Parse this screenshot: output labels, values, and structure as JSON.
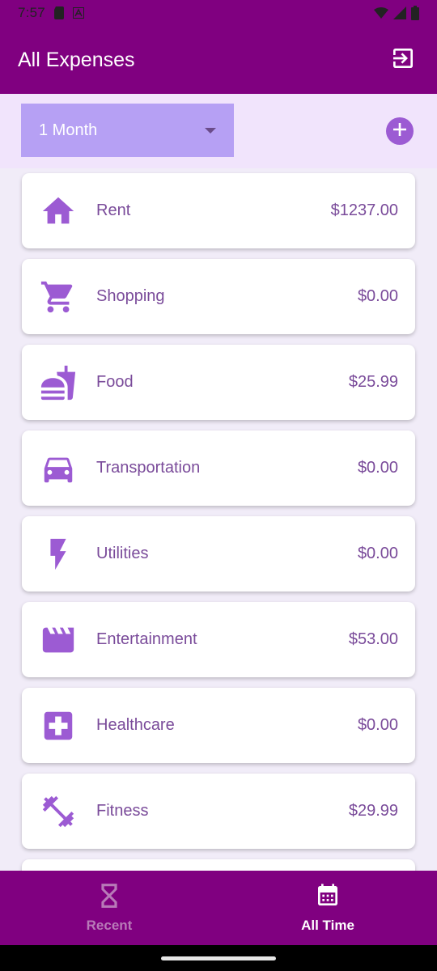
{
  "status_bar": {
    "time": "7:57",
    "icons": [
      "sim-card-icon",
      "a-badge-icon",
      "wifi-icon",
      "signal-icon",
      "battery-icon"
    ]
  },
  "app_bar": {
    "title": "All Expenses",
    "action_icon": "logout-icon"
  },
  "filter": {
    "selected": "1 Month",
    "add_icon": "add-circle-icon"
  },
  "expenses": [
    {
      "label": "Rent",
      "amount": "$1237.00",
      "icon": "home-icon"
    },
    {
      "label": "Shopping",
      "amount": "$0.00",
      "icon": "shopping-cart-icon"
    },
    {
      "label": "Food",
      "amount": "$25.99",
      "icon": "fastfood-icon"
    },
    {
      "label": "Transportation",
      "amount": "$0.00",
      "icon": "car-icon"
    },
    {
      "label": "Utilities",
      "amount": "$0.00",
      "icon": "bolt-icon"
    },
    {
      "label": "Entertainment",
      "amount": "$53.00",
      "icon": "movie-icon"
    },
    {
      "label": "Healthcare",
      "amount": "$0.00",
      "icon": "medical-icon"
    },
    {
      "label": "Fitness",
      "amount": "$29.99",
      "icon": "fitness-icon"
    }
  ],
  "bottom_nav": {
    "recent": {
      "label": "Recent",
      "icon": "hourglass-icon"
    },
    "all_time": {
      "label": "All Time",
      "icon": "calendar-icon"
    }
  },
  "colors": {
    "primary": "#800080",
    "accent": "#9c5bd3",
    "dropdown": "#b6a0f4",
    "text": "#7a4b9a"
  }
}
